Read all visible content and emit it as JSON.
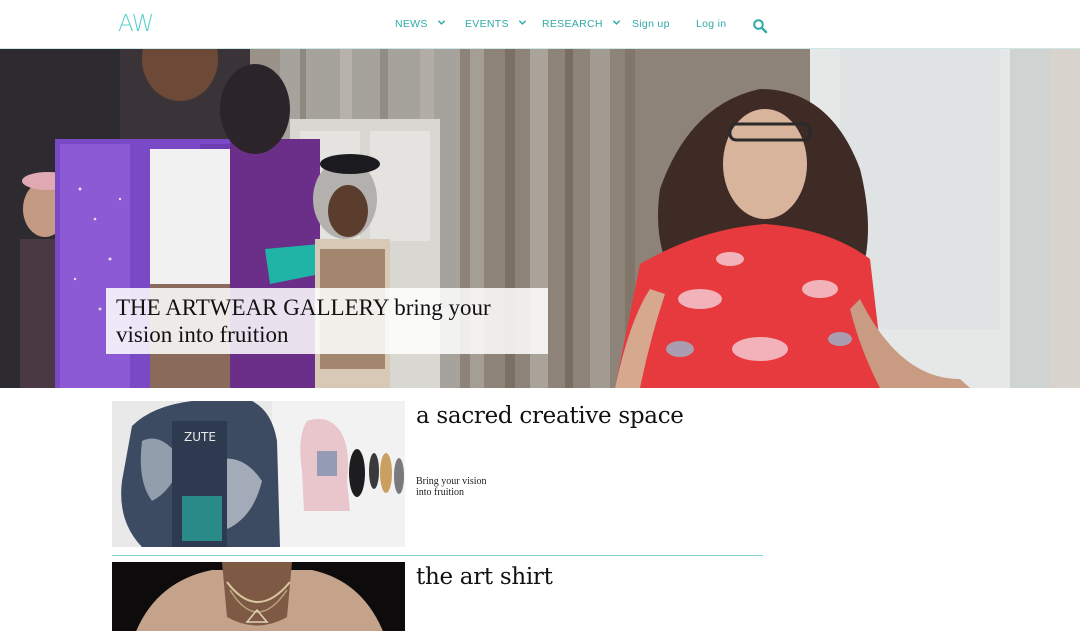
{
  "header": {
    "logo": "AW",
    "nav": {
      "news": "NEWS",
      "events": "EVENTS",
      "research": "RESEARCH",
      "signup": "Sign up",
      "login": "Log in"
    },
    "icons": {
      "dropdown": "chevron-down-icon",
      "search": "search-icon"
    }
  },
  "hero": {
    "caption_line1": "THE ARTWEAR GALLERY bring your",
    "caption_line2": "vision into fruition"
  },
  "cards": [
    {
      "title": "a sacred creative space",
      "desc_line1": "Bring your vision",
      "desc_line2": "into fruition"
    },
    {
      "title": "the art shirt"
    }
  ],
  "colors": {
    "accent": "#2fa9a6",
    "logo": "#5ccfcb",
    "divider": "#7fd1cf"
  }
}
